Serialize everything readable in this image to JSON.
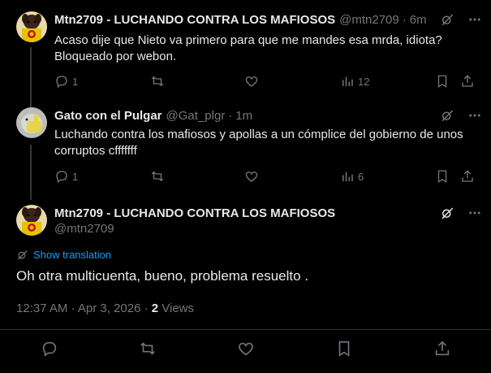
{
  "tweets": [
    {
      "name": "Mtn2709 - LUCHANDO CONTRA LOS MAFIOSOS",
      "handle": "@mtn2709",
      "time": "6m",
      "text_line1": "Acaso dije que Nieto va primero para que me mandes esa mrda, idiota?",
      "text_line2": "Bloqueado por webon.",
      "replies": "1",
      "views": "12"
    },
    {
      "name": "Gato con el Pulgar",
      "handle": "@Gat_plgr",
      "time": "1m",
      "text_line1": "Luchando contra los mafiosos y apollas a un cómplice del gobierno de unos",
      "text_line2": "corruptos cfffffff",
      "replies": "1",
      "views": "6"
    }
  ],
  "main_tweet": {
    "name": "Mtn2709 - LUCHANDO CONTRA LOS MAFIOSOS",
    "handle": "@mtn2709",
    "show_translation": "Show translation",
    "text": "Oh otra multicuenta, bueno, problema resuelto .",
    "timestamp": "12:37 AM · Apr 3, 2026 · ",
    "views_count": "2",
    "views_label": " Views"
  },
  "icons": {
    "reply": "reply-icon",
    "retweet": "retweet-icon",
    "like": "heart-icon",
    "views": "analytics-icon",
    "bookmark": "bookmark-icon",
    "share": "share-icon",
    "grok": "grok-icon",
    "more": "more-icon"
  },
  "colors": {
    "background": "#000000",
    "text": "#e7e9ea",
    "secondary": "#71767b",
    "accent": "#1d9bf0",
    "divider": "#2f3336"
  }
}
